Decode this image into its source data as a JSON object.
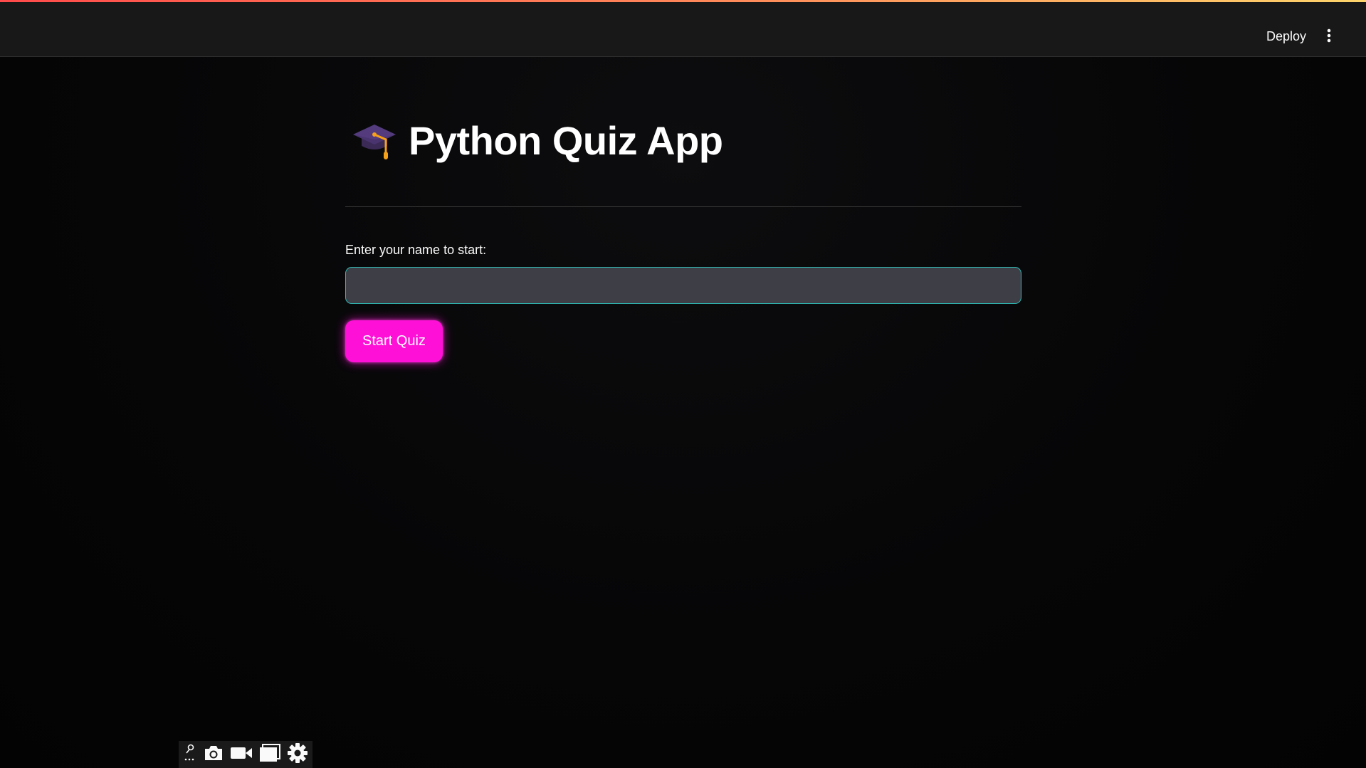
{
  "header": {
    "deploy_label": "Deploy",
    "menu_icon": "vertical-ellipsis-icon"
  },
  "main": {
    "title_icon": "graduation-cap-icon",
    "title": "Python Quiz App",
    "name_label": "Enter your name to start:",
    "name_value": "",
    "start_button_label": "Start Quiz"
  },
  "toolbar": {
    "icons": [
      "pin-dots-icon",
      "camera-icon",
      "video-camera-icon",
      "window-icon",
      "gear-icon"
    ]
  },
  "colors": {
    "accent_button": "#ff10d6",
    "input_border": "#2fb8b3",
    "input_bg": "#3d3e46",
    "header_bg": "#181818"
  }
}
